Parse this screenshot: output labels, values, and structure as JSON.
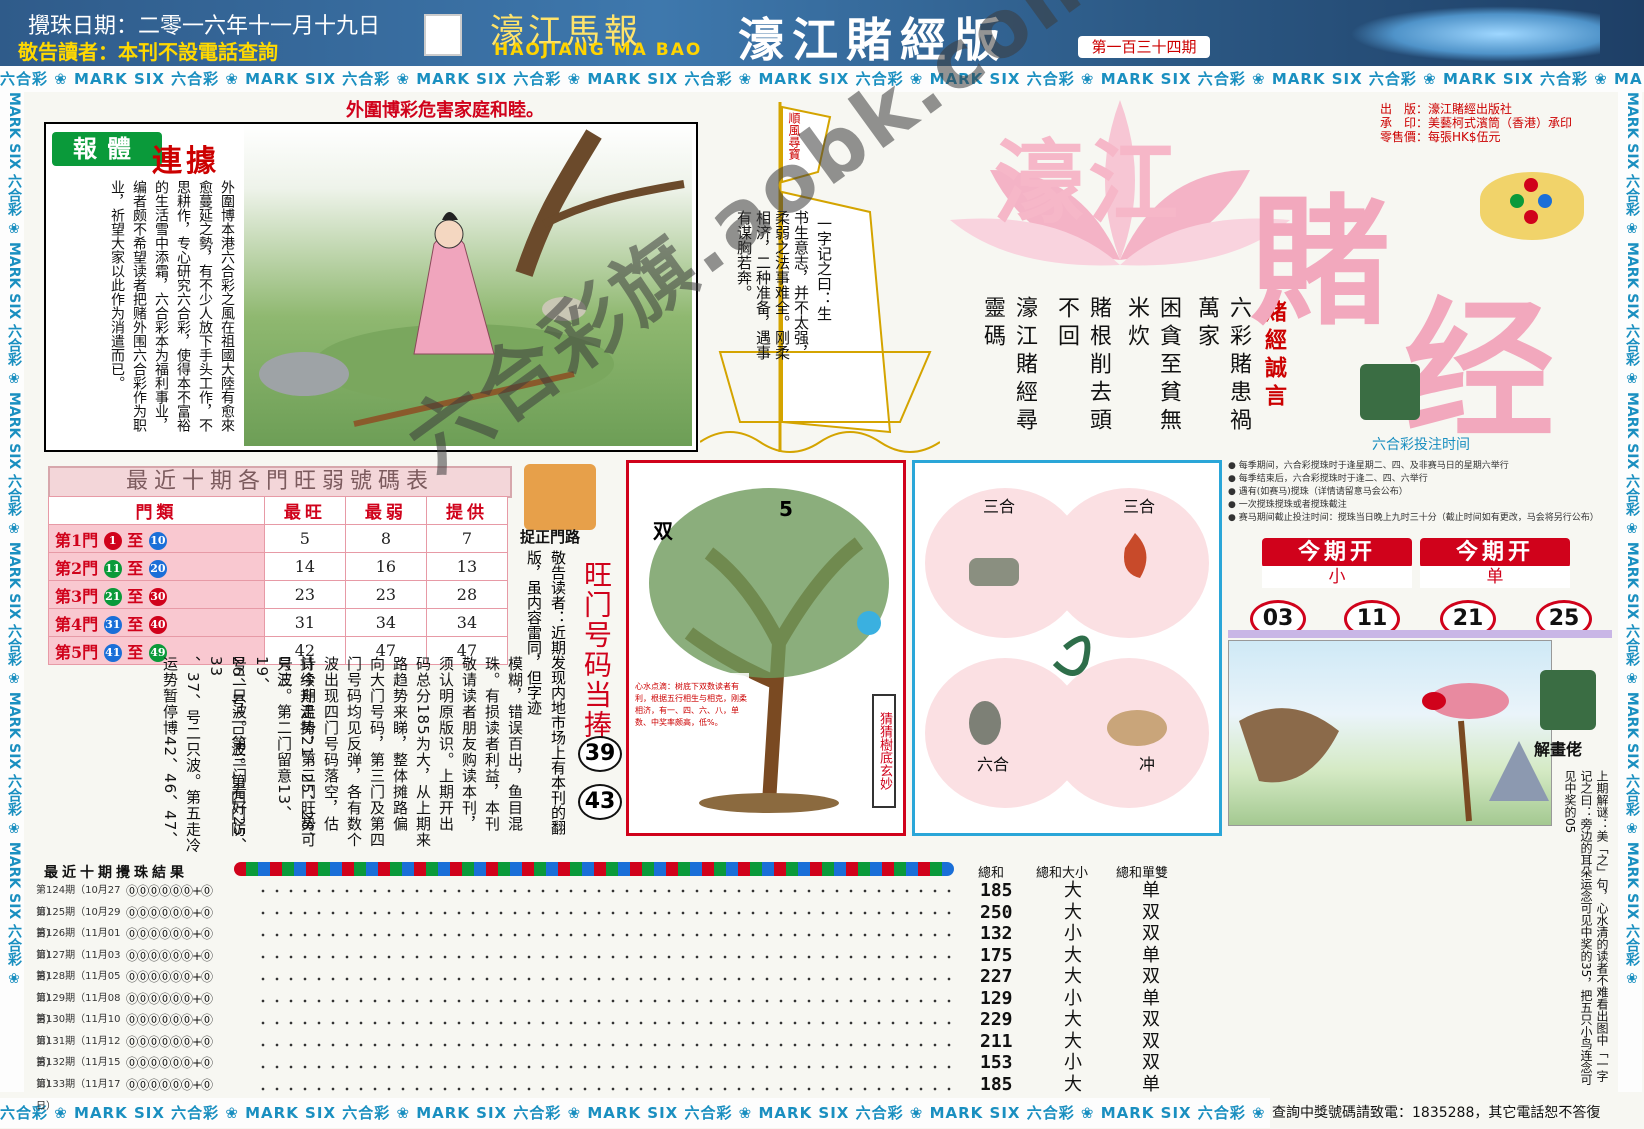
{
  "header": {
    "draw_date": "攪珠日期：二零一六年十一月十九日",
    "warning": "敬告讀者：本刊不設電話查詢",
    "brand_cn": "濠江馬報",
    "brand_en": "HAOJIANG MA BAO",
    "edition": "濠江賭經版",
    "issue": "第一百三十四期"
  },
  "border": {
    "repeat_text": "六合彩 ❀ MARK SIX 六合彩 ❀ MARK SIX 六合彩 ❀ MARK SIX 六合彩 ❀ MARK SIX 六合彩 ❀ MARK SIX 六合彩 ❀ MARK SIX 六合彩 ❀ MARK SIX 六合彩 ❀ MARK SIX 六合彩 ❀ MARK SIX 六合彩 ❀ MARK SIX",
    "side_text": "MARK SIX 六合彩 ❀ MARK SIX 六合彩 ❀ MARK SIX 六合彩 ❀ MARK SIX 六合彩 ❀ MARK SIX 六合彩 ❀ MARK SIX 六合彩 ❀"
  },
  "slogan": "外圍博彩危害家庭和睦。",
  "article": {
    "badge": "報體",
    "badge2": "連據",
    "body": "外圍博本港六合彩之風在祖國大陸有愈來愈蔓延之勢，有不少人放下手头工作，不思耕作，专心研究六合彩，使得本不富裕的生活雪中添霜，六合彩本为福利事业，编者颇不希望读者把赌外围六合彩作为职业，祈望大家以此作为消遣而已。"
  },
  "sail": {
    "flag": "順風尋寶",
    "text1": "一字记之曰：生",
    "text2": "书生意志，并不太强，柔弱之法事难全。刚柔相济，二种准备，遇事有谋胸若奔。"
  },
  "poem": {
    "title": "賭經誠言",
    "lines": [
      "六彩賭患禍萬家",
      "困貪至貧無米炊",
      "賭根削去頭不回",
      "濠江賭經尋靈碼"
    ]
  },
  "logo": {
    "hao": "濠江",
    "du": "賭",
    "jing": "经"
  },
  "publisher": {
    "line1": "出　版：濠江賭經出版社",
    "line2": "承　印：美藝柯式濱筒（香港）承印",
    "line3": "零售價：每張HK$伍元"
  },
  "time_info": {
    "title": "六合彩投注时间",
    "notes": [
      "● 每季期间，六合彩搅珠时于逢星期二、四、及非赛马日的星期六举行",
      "● 每季结束后，六合彩搅珠时于逢二、四、六举行",
      "● 遇有(如赛马)搅珠（详情请留意马会公布）",
      "● 一次搅珠搅珠或者搅珠截注",
      "● 赛马期间截止投注时间：搅珠当日晚上九时三十分（截止时间如有更改，马会将另行公布）"
    ]
  },
  "open": {
    "label1": "今期开",
    "value1": "小",
    "label2": "今期开",
    "value2": "单",
    "picks": [
      "03",
      "11",
      "21",
      "25"
    ]
  },
  "hot_table": {
    "title": "最近十期各門旺弱號碼表",
    "headers": [
      "門類",
      "最旺",
      "最弱",
      "提供"
    ],
    "rows": [
      {
        "gate": "第1門",
        "from": "1",
        "to": "10",
        "from_color": "#d0021b",
        "to_color": "#1a6fd8",
        "hot": "5",
        "cold": "8",
        "tip": "7"
      },
      {
        "gate": "第2門",
        "from": "11",
        "to": "20",
        "from_color": "#0a9a3a",
        "to_color": "#1a6fd8",
        "hot": "14",
        "cold": "16",
        "tip": "13"
      },
      {
        "gate": "第3門",
        "from": "21",
        "to": "30",
        "from_color": "#0a9a3a",
        "to_color": "#d0021b",
        "hot": "23",
        "cold": "23",
        "tip": "28"
      },
      {
        "gate": "第4門",
        "from": "31",
        "to": "40",
        "from_color": "#1a6fd8",
        "to_color": "#d0021b",
        "hot": "31",
        "cold": "34",
        "tip": "34"
      },
      {
        "gate": "第5門",
        "from": "41",
        "to": "49",
        "from_color": "#1a6fd8",
        "to_color": "#0a9a3a",
        "hot": "42",
        "cold": "47",
        "tip": "47"
      }
    ]
  },
  "mid_columns": [
    "模糊，错误百出，鱼目混",
    "珠。有损读者利益，本刊",
    "敬请读者朋友购读本刊，",
    "须认明原版识。上期开出",
    "码总分185为大，从上期来",
    "路趋势来睇，整体摊路偏",
    "向大门号码，第三门及第四",
    "门号码均见反弹，各有数个",
    "波出现四门号码落空，估",
    "计今期走势，第三门旺势可",
    "持续升温捧21、25、28、号三",
    "只波。第二门留意13、19、",
    "号二只波。第三门看好25、",
    "26、号二只波。第四门防33",
    "、37、号二只波。第五走冷",
    "运势暂停博42、46、47、"
  ],
  "gate_label": "捉正門路",
  "note": "敬告读者：近期发现内地市场上有本刊的翻版，虽内容雷同，但字迹",
  "wang_title": "旺门号码当捧",
  "wang_numbers": [
    "39",
    "43"
  ],
  "tree": {
    "label_left": "双",
    "label_right": "5",
    "side": "猜猜樹底玄妙",
    "caption": "心水点滴：树底下双数读者有利，根据五行相生与相克，刚柔相济，有一、四、六、八，单数、中奖率颇高，低%。"
  },
  "zodiac": {
    "tl": "三合",
    "tr": "三合",
    "bl": "六合",
    "br": "冲"
  },
  "pic2": {
    "label": "解畫佬",
    "text": "上期解谜：美「之」句，心水清的读者不难看出图中「一字记之曰：旁边的耳朵运念可见中奖的35，把五只小鸟连念可见中奖的05"
  },
  "results": {
    "title": "最近十期攪珠結果",
    "headers": [
      "總和",
      "總和大小",
      "總和單雙"
    ],
    "rows": [
      {
        "label": "第124期（10月27日）",
        "balls": "⓪⓪⓪⓪⓪⓪+⓪",
        "sum": "185",
        "bs": "大",
        "oe": "单"
      },
      {
        "label": "第125期（10月29日）",
        "balls": "⓪⓪⓪⓪⓪⓪+⓪",
        "sum": "250",
        "bs": "大",
        "oe": "双"
      },
      {
        "label": "第126期（11月01日）",
        "balls": "⓪⓪⓪⓪⓪⓪+⓪",
        "sum": "132",
        "bs": "小",
        "oe": "双"
      },
      {
        "label": "第127期（11月03日）",
        "balls": "⓪⓪⓪⓪⓪⓪+⓪",
        "sum": "175",
        "bs": "大",
        "oe": "单"
      },
      {
        "label": "第128期（11月05日）",
        "balls": "⓪⓪⓪⓪⓪⓪+⓪",
        "sum": "227",
        "bs": "大",
        "oe": "双"
      },
      {
        "label": "第129期（11月08日）",
        "balls": "⓪⓪⓪⓪⓪⓪+⓪",
        "sum": "129",
        "bs": "小",
        "oe": "单"
      },
      {
        "label": "第130期（11月10日）",
        "balls": "⓪⓪⓪⓪⓪⓪+⓪",
        "sum": "229",
        "bs": "大",
        "oe": "双"
      },
      {
        "label": "第131期（11月12日）",
        "balls": "⓪⓪⓪⓪⓪⓪+⓪",
        "sum": "211",
        "bs": "大",
        "oe": "双"
      },
      {
        "label": "第132期（11月15日）",
        "balls": "⓪⓪⓪⓪⓪⓪+⓪",
        "sum": "153",
        "bs": "小",
        "oe": "双"
      },
      {
        "label": "第133期（11月17日）",
        "balls": "⓪⓪⓪⓪⓪⓪+⓪",
        "sum": "185",
        "bs": "大",
        "oe": "单"
      }
    ]
  },
  "footer": "查詢中獎號碼請致電：1835288，其它電話恕不答復",
  "watermark": "六合彩旗.aobk.com",
  "colors": {
    "accent_red": "#d0021b",
    "border_blue": "#1a8fc0",
    "logo_pink": "#f2a8bd"
  }
}
